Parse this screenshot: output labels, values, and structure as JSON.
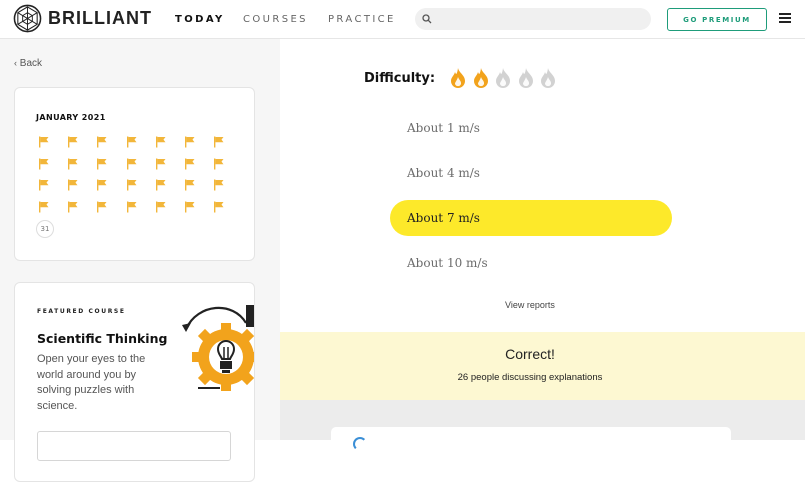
{
  "brand": {
    "name": "BRILLIANT",
    "icon": "brilliant-logo-icon"
  },
  "nav": {
    "links": [
      {
        "label": "TODAY",
        "active": true
      },
      {
        "label": "COURSES",
        "active": false
      },
      {
        "label": "PRACTICE",
        "active": false
      }
    ],
    "search": {
      "placeholder": "",
      "value": "",
      "icon": "search-icon"
    },
    "premium_label": "GO PREMIUM",
    "menu_icon": "hamburger-menu-icon"
  },
  "sidebar": {
    "back_label": "Back",
    "calendar": {
      "title": "JANUARY 2021",
      "flag_color": "#f2b63a",
      "completed_days": 28,
      "current_day_label": "31"
    },
    "featured": {
      "eyebrow": "FEATURED COURSE",
      "title": "Scientific Thinking",
      "description": "Open your eyes to the world around you by solving puzzles with science.",
      "art_icon": "lightbulb-gear-icon"
    }
  },
  "problem": {
    "difficulty_label": "Difficulty:",
    "difficulty_level": 2,
    "difficulty_max": 5,
    "flame_active_color": "#f2a31c",
    "flame_inactive_color": "#d2d2d2",
    "options": [
      {
        "label": "About 1 m/s",
        "selected": false
      },
      {
        "label": "About 4 m/s",
        "selected": false
      },
      {
        "label": "About 7 m/s",
        "selected": true
      },
      {
        "label": "About 10 m/s",
        "selected": false
      }
    ],
    "view_reports_label": "View reports",
    "result": {
      "title": "Correct!",
      "subtitle": "26 people discussing explanations"
    }
  },
  "colors": {
    "accent_green": "#1e9c7a",
    "selected_yellow": "#fde92a",
    "correct_banner": "#fdf8d2"
  }
}
